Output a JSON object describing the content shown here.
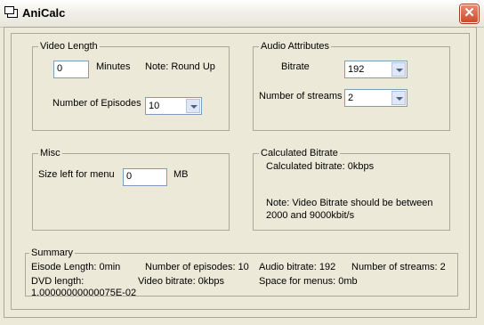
{
  "window": {
    "title": "AniCalc",
    "close_glyph": "✕"
  },
  "video_length": {
    "title": "Video Length",
    "minutes_value": "0",
    "minutes_label": "Minutes",
    "note": "Note: Round Up",
    "episodes_label": "Number of Episodes",
    "episodes_value": "10"
  },
  "audio": {
    "title": "Audio Attributes",
    "bitrate_label": "Bitrate",
    "bitrate_value": "192",
    "streams_label": "Number of streams",
    "streams_value": "2"
  },
  "misc": {
    "title": "Misc",
    "size_label": "Size left for menu",
    "size_value": "0",
    "unit": "MB"
  },
  "calculated": {
    "title": "Calculated Bitrate",
    "result": "Calculated bitrate: 0kbps",
    "note_line1": "Note: Video Bitrate should be between",
    "note_line2": "2000 and 9000kbit/s"
  },
  "summary": {
    "title": "Summary",
    "episode_length": "Eisode Length: 0min",
    "num_episodes": "Number of episodes: 10",
    "audio_bitrate": "Audio bitrate: 192",
    "num_streams": "Number of streams: 2",
    "dvd_length": "DVD length:",
    "dvd_length_value": "1.00000000000075E-02",
    "video_bitrate": "Video bitrate: 0kbps",
    "space_menus": "Space for menus: 0mb"
  },
  "icons": {
    "app": "window-icon",
    "close": "close-icon",
    "dropdown": "chevron-down-icon"
  }
}
